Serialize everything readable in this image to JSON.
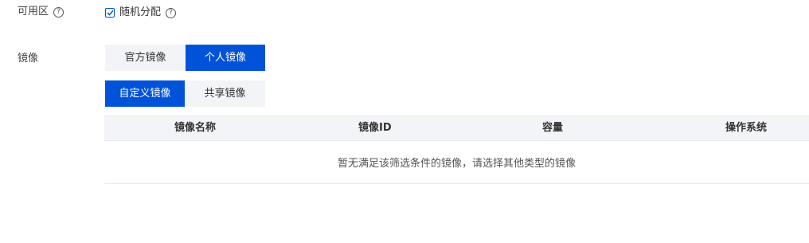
{
  "availability_zone": {
    "label": "可用区",
    "help": "?",
    "checkbox_label": "随机分配",
    "checkbox_help": "?",
    "checked": true
  },
  "image": {
    "label": "镜像",
    "source_tabs": [
      {
        "label": "官方镜像",
        "active": false
      },
      {
        "label": "个人镜像",
        "active": true
      }
    ],
    "type_tabs": [
      {
        "label": "自定义镜像",
        "active": true
      },
      {
        "label": "共享镜像",
        "active": false
      }
    ],
    "table": {
      "columns": [
        "镜像名称",
        "镜像ID",
        "容量",
        "操作系统"
      ],
      "empty_text": "暂无满足该筛选条件的镜像，请选择其他类型的镜像"
    }
  },
  "colors": {
    "accent": "#0052d9",
    "inactive_bg": "#f3f4f7",
    "border": "#e6e8ec"
  }
}
